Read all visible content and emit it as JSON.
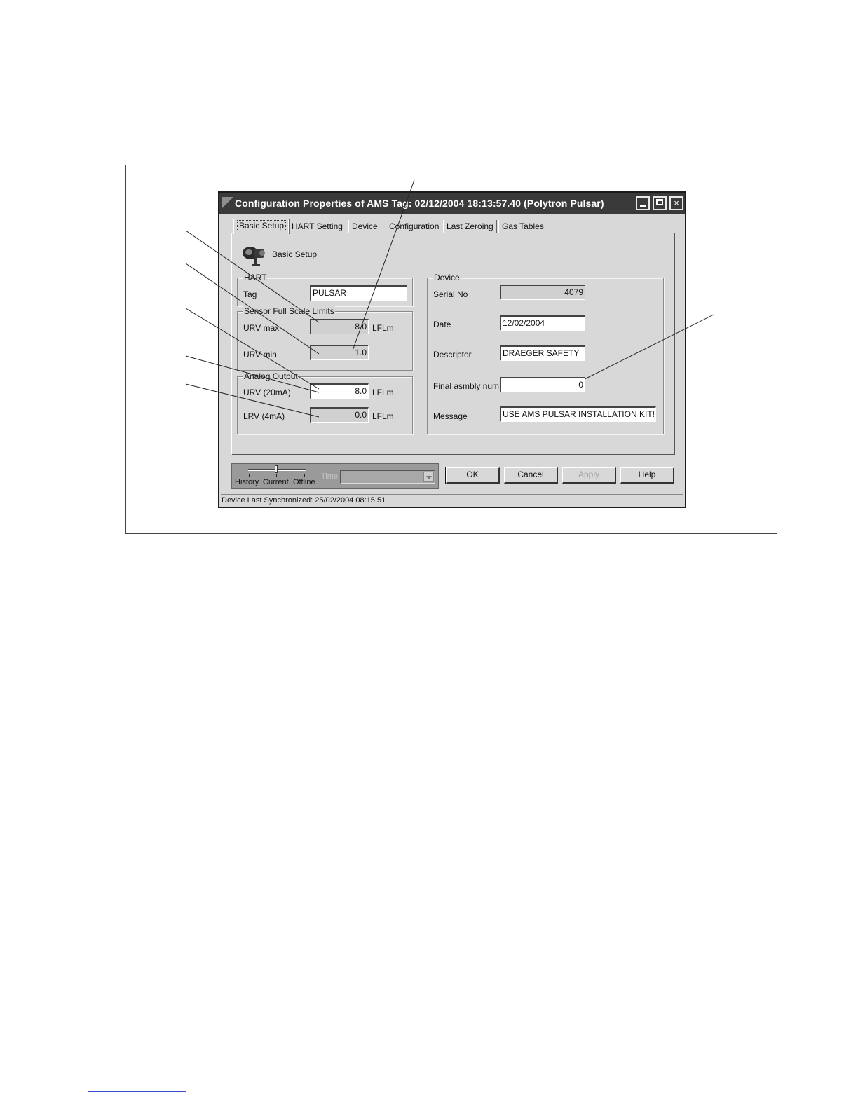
{
  "window": {
    "title": "Configuration Properties of AMS Tag: 02/12/2004 18:13:57.40 (Polytron Pulsar)",
    "controls": {
      "minimize": "minimize-icon",
      "maximize": "maximize-icon",
      "close": "×"
    }
  },
  "tabs": [
    {
      "label": "Basic Setup",
      "active": true
    },
    {
      "label": "HART Setting",
      "active": false
    },
    {
      "label": "Device",
      "active": false
    },
    {
      "label": "Configuration",
      "active": false
    },
    {
      "label": "Last Zeroing",
      "active": false
    },
    {
      "label": "Gas Tables",
      "active": false
    }
  ],
  "header": {
    "icon": "transmitter-icon",
    "title": "Basic Setup"
  },
  "hart": {
    "legend": "HART",
    "tag_label": "Tag",
    "tag_value": "PULSAR"
  },
  "sensor_limits": {
    "legend": "Sensor Full Scale Limits",
    "urv_max_label": "URV max",
    "urv_max_value": "8.0",
    "urv_max_unit": "LFLm",
    "urv_min_label": "URV min",
    "urv_min_value": "1.0"
  },
  "analog_output": {
    "legend": "Analog Output",
    "urv_label": "URV (20mA)",
    "urv_value": "8.0",
    "urv_unit": "LFLm",
    "lrv_label": "LRV (4mA)",
    "lrv_value": "0.0",
    "lrv_unit": "LFLm"
  },
  "device": {
    "legend": "Device",
    "serial_label": "Serial No",
    "serial_value": "4079",
    "date_label": "Date",
    "date_value": "12/02/2004",
    "descriptor_label": "Descriptor",
    "descriptor_value": "DRAEGER SAFETY",
    "final_label": "Final asmbly num",
    "final_value": "0",
    "message_label": "Message",
    "message_value": "USE AMS PULSAR INSTALLATION KIT!"
  },
  "time_control": {
    "modes": [
      "History",
      "Current",
      "Offline"
    ],
    "selected_mode": "Current",
    "time_label": "Time",
    "time_value": ""
  },
  "buttons": {
    "ok": "OK",
    "cancel": "Cancel",
    "apply": "Apply",
    "help": "Help"
  },
  "status": "Device Last Synchronized: 25/02/2004 08:15:51",
  "colors": {
    "titlebar": "#3a3a3a",
    "dialog": "#d8d8d8"
  }
}
